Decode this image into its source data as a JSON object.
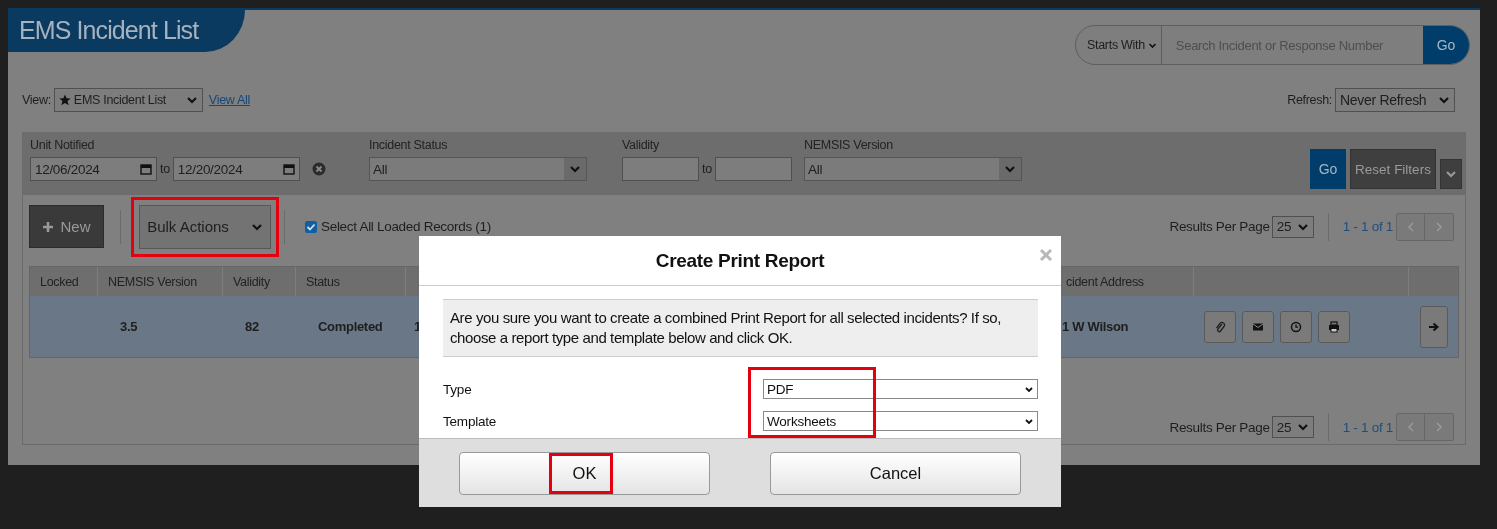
{
  "header": {
    "title": "EMS Incident List"
  },
  "search": {
    "mode": "Starts With",
    "placeholder": "Search Incident or Response Number",
    "button": "Go"
  },
  "view": {
    "label": "View:",
    "value": "EMS Incident List",
    "link": "View All"
  },
  "refresh": {
    "label": "Refresh:",
    "value": "Never Refresh"
  },
  "filters": {
    "unit_notified": {
      "label": "Unit Notified",
      "from": "12/06/2024",
      "to_label": "to",
      "to": "12/20/2024"
    },
    "incident_status": {
      "label": "Incident Status",
      "value": "All"
    },
    "validity": {
      "label": "Validity",
      "to_label": "to"
    },
    "nemsis_version": {
      "label": "NEMSIS Version",
      "value": "All"
    },
    "go": "Go",
    "reset": "Reset Filters"
  },
  "toolbar": {
    "new": "New",
    "bulk_actions": {
      "label": "Bulk Actions",
      "highlighted": true
    },
    "select_all": {
      "label": "Select All Loaded Records (1)",
      "checked": true
    }
  },
  "pagination": [
    {
      "label": "Results Per Page",
      "per_page": "25",
      "range": "1 - 1 of 1"
    },
    {
      "label": "Results Per Page",
      "per_page": "25",
      "range": "1 - 1 of 1"
    }
  ],
  "table": {
    "columns": [
      "Locked",
      "NEMSIS Version",
      "Validity",
      "Status",
      null,
      "cident Address"
    ],
    "rows": [
      {
        "selected": true,
        "nemsis_version": "3.5",
        "validity": "82",
        "status": "Completed",
        "column_5": "1",
        "address": "1 W Wilson"
      }
    ]
  },
  "dialog": {
    "title": "Create Print Report",
    "message": "Are you sure you want to create a combined Print Report for all selected incidents? If so, choose a report type and template below and click OK.",
    "fields_highlighted": true,
    "fields": [
      {
        "label": "Type",
        "value": "PDF"
      },
      {
        "label": "Template",
        "value": "Worksheets"
      }
    ],
    "buttons": [
      {
        "label": "OK",
        "highlighted": true
      },
      {
        "label": "Cancel",
        "highlighted": false
      }
    ]
  }
}
